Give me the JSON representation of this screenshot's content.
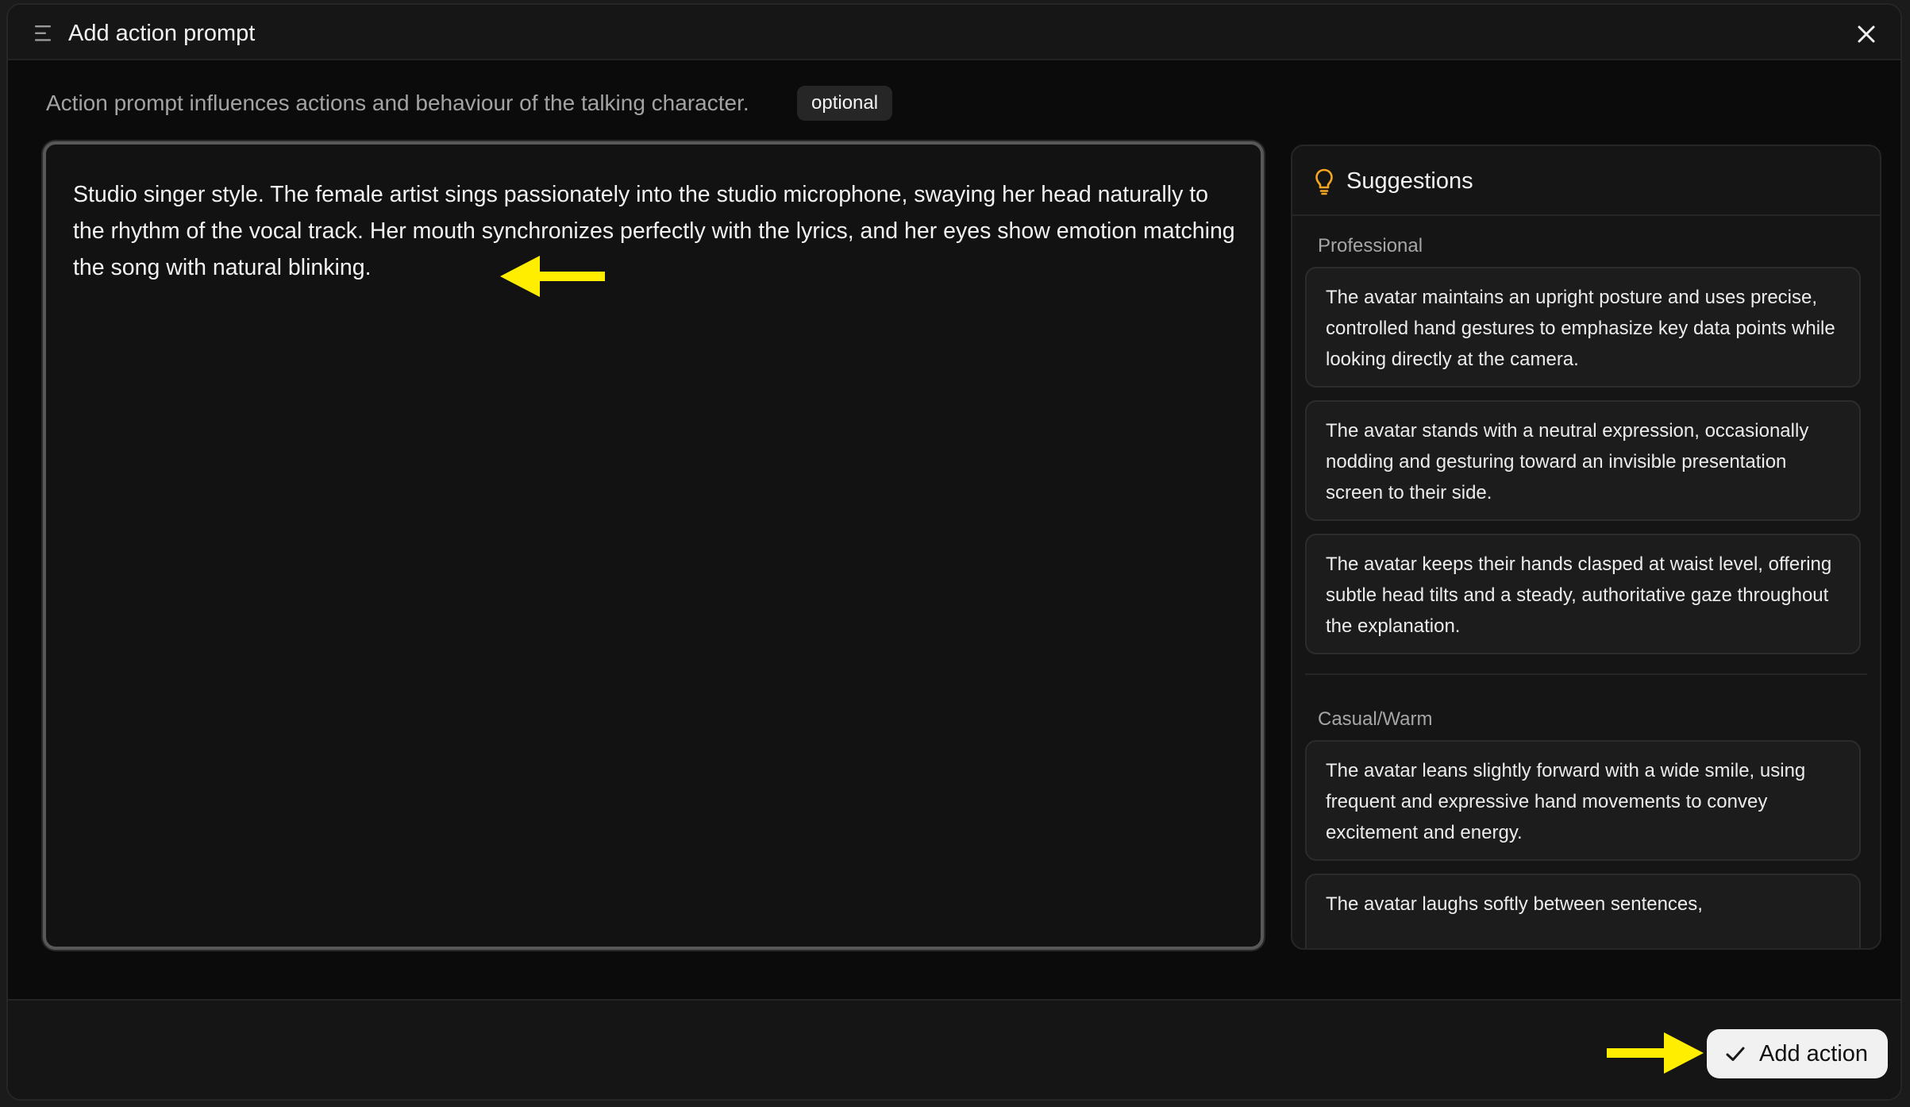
{
  "header": {
    "title": "Add action prompt",
    "menu_icon": "menu-icon",
    "close_icon": "close-icon"
  },
  "description": {
    "text": "Action prompt influences actions and behaviour of the talking character.",
    "badge": "optional"
  },
  "editor": {
    "value": "Studio singer style. The female artist sings passionately into the studio microphone, swaying her head naturally to the rhythm of the vocal track. Her mouth synchronizes perfectly with the lyrics, and her eyes show emotion matching the song with natural blinking."
  },
  "suggestions": {
    "title": "Suggestions",
    "icon": "lightbulb-icon",
    "icon_color": "#f5a623",
    "groups": [
      {
        "label": "Professional",
        "items": [
          "The avatar maintains an upright posture and uses precise, controlled hand gestures to emphasize key data points while looking directly at the camera.",
          "The avatar stands with a neutral expression, occasionally nodding and gesturing toward an invisible presentation screen to their side.",
          "The avatar keeps their hands clasped at waist level, offering subtle head tilts and a steady, authoritative gaze throughout the explanation."
        ]
      },
      {
        "label": "Casual/Warm",
        "items": [
          "The avatar leans slightly forward with a wide smile, using frequent and expressive hand movements to convey excitement and energy.",
          "The avatar laughs softly between sentences,"
        ]
      }
    ]
  },
  "footer": {
    "add_action_label": "Add action",
    "check_icon": "check-icon"
  },
  "annotations": {
    "arrow_color": "#ffee00"
  }
}
